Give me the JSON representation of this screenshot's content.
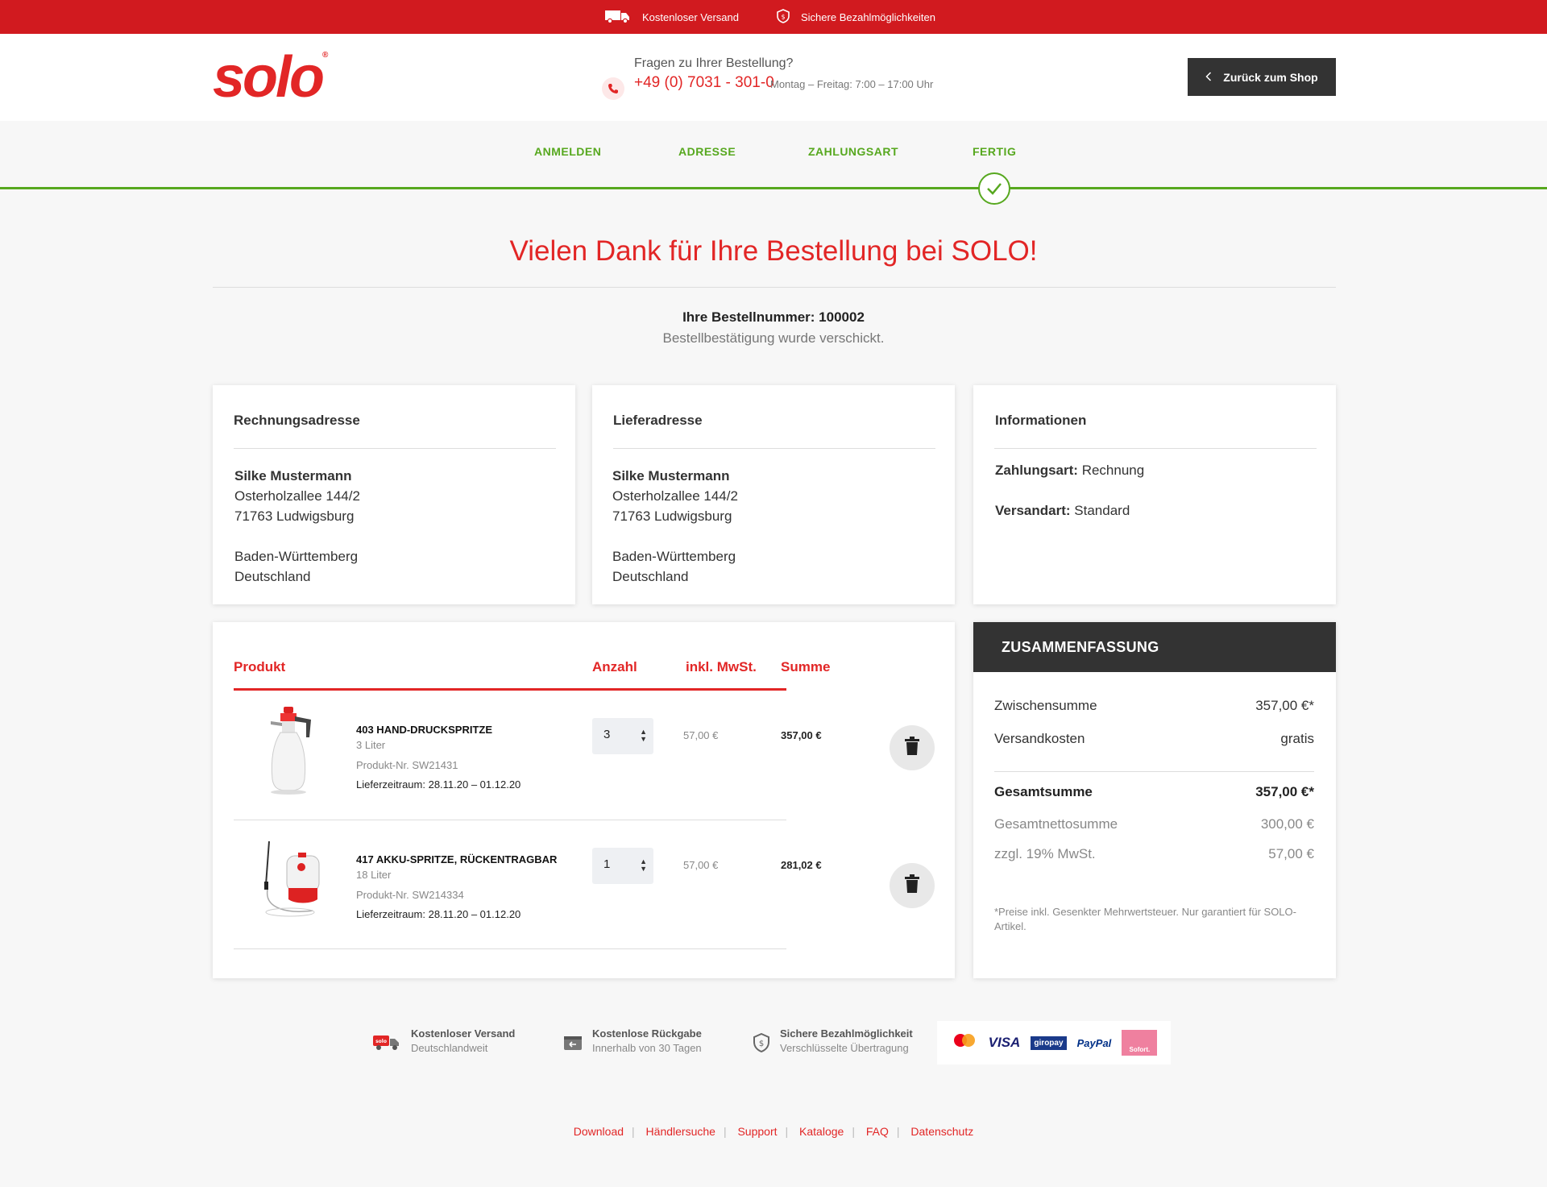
{
  "topbar": {
    "shipping": "Kostenloser Versand",
    "payment": "Sichere Bezahlmöglichkeiten"
  },
  "header": {
    "logo": "solo",
    "question": "Fragen zu Ihrer Bestellung?",
    "phone": "+49 (0) 7031 - 301-0",
    "hours": "Montag – Freitag: 7:00 – 17:00 Uhr",
    "back_button": "Zurück zum Shop"
  },
  "steps": [
    "ANMELDEN",
    "ADRESSE",
    "ZAHLUNGSART",
    "FERTIG"
  ],
  "headline": "Vielen Dank für Ihre Bestellung bei SOLO!",
  "order": {
    "number_label": "Ihre Bestellnummer: 100002",
    "confirmation": "Bestellbestätigung wurde verschickt."
  },
  "billing": {
    "title": "Rechnungsadresse",
    "name": "Silke Mustermann",
    "street": "Osterholzallee 144/2",
    "city": "71763 Ludwigsburg",
    "state": "Baden-Württemberg",
    "country": "Deutschland"
  },
  "shipping": {
    "title": "Lieferadresse",
    "name": "Silke Mustermann",
    "street": "Osterholzallee 144/2",
    "city": "71763 Ludwigsburg",
    "state": "Baden-Württemberg",
    "country": "Deutschland"
  },
  "info": {
    "title": "Informationen",
    "payment_label": "Zahlungsart:",
    "payment_value": "Rechnung",
    "shipping_label": "Versandart:",
    "shipping_value": "Standard"
  },
  "table": {
    "headers": {
      "product": "Produkt",
      "qty": "Anzahl",
      "price": "inkl. MwSt.",
      "sum": "Summe"
    },
    "rows": [
      {
        "name": "403 HAND-DRUCKSPRITZE",
        "size": "3 Liter",
        "sku": "Produkt-Nr. SW21431",
        "delivery": "Lieferzeitraum: 28.11.20 – 01.12.20",
        "qty": "3",
        "price": "57,00 €",
        "sum": "357,00 €"
      },
      {
        "name": "417 AKKU-SPRITZE, RÜCKENTRAGBAR",
        "size": "18 Liter",
        "sku": "Produkt-Nr. SW214334",
        "delivery": "Lieferzeitraum: 28.11.20 – 01.12.20",
        "qty": "1",
        "price": "57,00 €",
        "sum": "281,02 €"
      }
    ]
  },
  "summary": {
    "title": "ZUSAMMENFASSUNG",
    "subtotal_label": "Zwischensumme",
    "subtotal": "357,00 €*",
    "shipping_label": "Versandkosten",
    "shipping": "gratis",
    "total_label": "Gesamtsumme",
    "total": "357,00 €*",
    "net_label": "Gesamtnettosumme",
    "net": "300,00 €",
    "vat_label": "zzgl. 19% MwSt.",
    "vat": "57,00 €",
    "note": "*Preise inkl. Gesenkter Mehrwertsteuer. Nur garantiert für SOLO-Artikel."
  },
  "trust": [
    {
      "title": "Kostenloser Versand",
      "sub": "Deutschlandweit",
      "icon": "truck-icon"
    },
    {
      "title": "Kostenlose Rückgabe",
      "sub": "Innerhalb von 30 Tagen",
      "icon": "return-icon"
    },
    {
      "title": "Sichere Bezahlmöglichkeit",
      "sub": "Verschlüsselte Übertragung",
      "icon": "shield-icon"
    }
  ],
  "payments": [
    "mastercard",
    "VISA",
    "giropay",
    "PayPal",
    "Sofort."
  ],
  "footer_links": [
    "Download",
    "Händlersuche",
    "Support",
    "Kataloge",
    "FAQ",
    "Datenschutz"
  ],
  "colors": {
    "brand_red": "#e22626",
    "topbar_red": "#d11a1f",
    "green": "#57a81f",
    "dark": "#333333"
  }
}
